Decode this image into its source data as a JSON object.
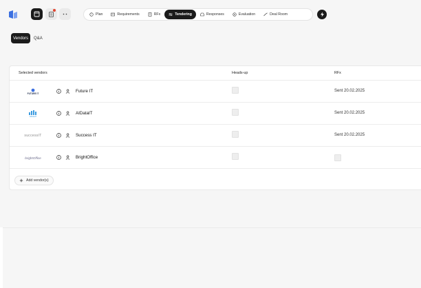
{
  "nav": {
    "tabs": [
      {
        "label": "Plan",
        "icon": "calendar-icon"
      },
      {
        "label": "Requirements",
        "icon": "list-icon"
      },
      {
        "label": "RFx",
        "icon": "document-icon"
      },
      {
        "label": "Tendering",
        "icon": "tendering-icon",
        "active": true
      },
      {
        "label": "Responses",
        "icon": "inbox-icon"
      },
      {
        "label": "Evaluation",
        "icon": "evaluation-icon"
      },
      {
        "label": "Deal Room",
        "icon": "handshake-icon"
      }
    ]
  },
  "subtabs": [
    {
      "label": "Vendors",
      "active": true
    },
    {
      "label": "Q&A",
      "active": false
    }
  ],
  "table": {
    "headers": {
      "vendors": "Selected vendors",
      "headsup": "Heads-up",
      "rfx": "RFx"
    },
    "rows": [
      {
        "logo": "FUTURE IT",
        "name": "Future IT",
        "rfx": "Sent 20.02.2025"
      },
      {
        "logo": "AIDataIT",
        "name": "AIDataIT",
        "rfx": "Sent 20.02.2025"
      },
      {
        "logo": "successIT",
        "name": "Success IT",
        "rfx": "Sent 20.02.2025"
      },
      {
        "logo": "brightOffice",
        "name": "BrightOffice",
        "rfx": ""
      }
    ],
    "add_label": "Add vendor(s)"
  },
  "colors": {
    "accent": "#1b1b1b",
    "notification": "#e2452f",
    "logo_blue": "#3b6fe0"
  }
}
